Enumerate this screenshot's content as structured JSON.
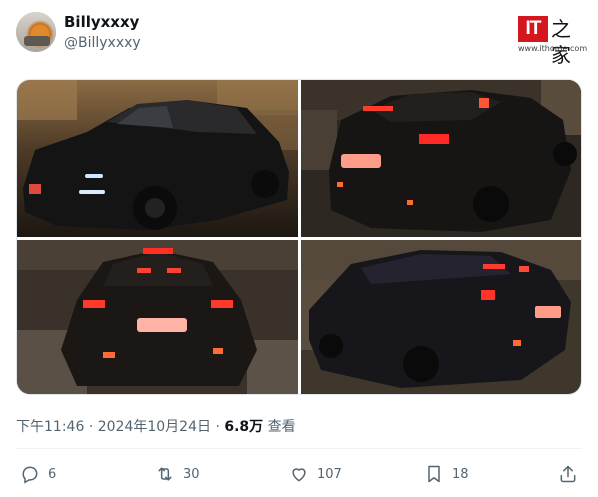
{
  "author": {
    "display_name": "Billyxxxy",
    "handle": "@Billyxxxy"
  },
  "watermark": {
    "mark": "IT",
    "chinese": "之家",
    "url": "www.ithome.com"
  },
  "tweet": {
    "time": "下午11:46",
    "sep1": "·",
    "date": "2024年10月24日",
    "sep2": "·",
    "views_count": "6.8万",
    "views_label": "查看"
  },
  "actions": {
    "replies": "6",
    "retweets": "30",
    "likes": "107",
    "bookmarks": "18"
  },
  "icons": [
    "reply-icon",
    "retweet-icon",
    "like-icon",
    "bookmark-icon",
    "share-icon"
  ],
  "colors": {
    "text_primary": "#0f1419",
    "text_secondary": "#536471",
    "ithome_red": "#d4161e"
  }
}
